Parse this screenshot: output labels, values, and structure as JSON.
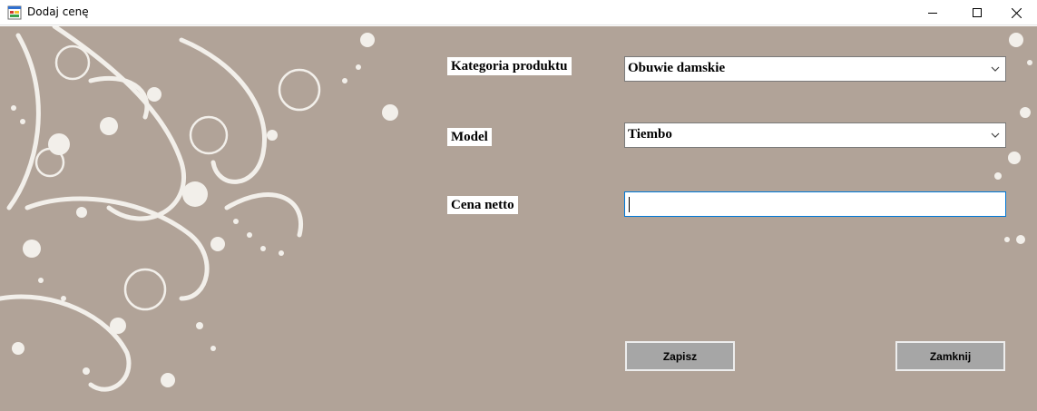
{
  "window": {
    "title": "Dodaj cenę",
    "icons": {
      "app": "windows-form-icon",
      "minimize": "minimize-icon",
      "maximize": "maximize-icon",
      "close": "close-icon"
    }
  },
  "form": {
    "background_color": "#b1a398",
    "category": {
      "label": "Kategoria produktu",
      "value": "Obuwie damskie"
    },
    "model": {
      "label": "Model",
      "value": "Tiembo"
    },
    "price": {
      "label": "Cena netto",
      "value": ""
    },
    "buttons": {
      "save": "Zapisz",
      "close": "Zamknij"
    }
  }
}
